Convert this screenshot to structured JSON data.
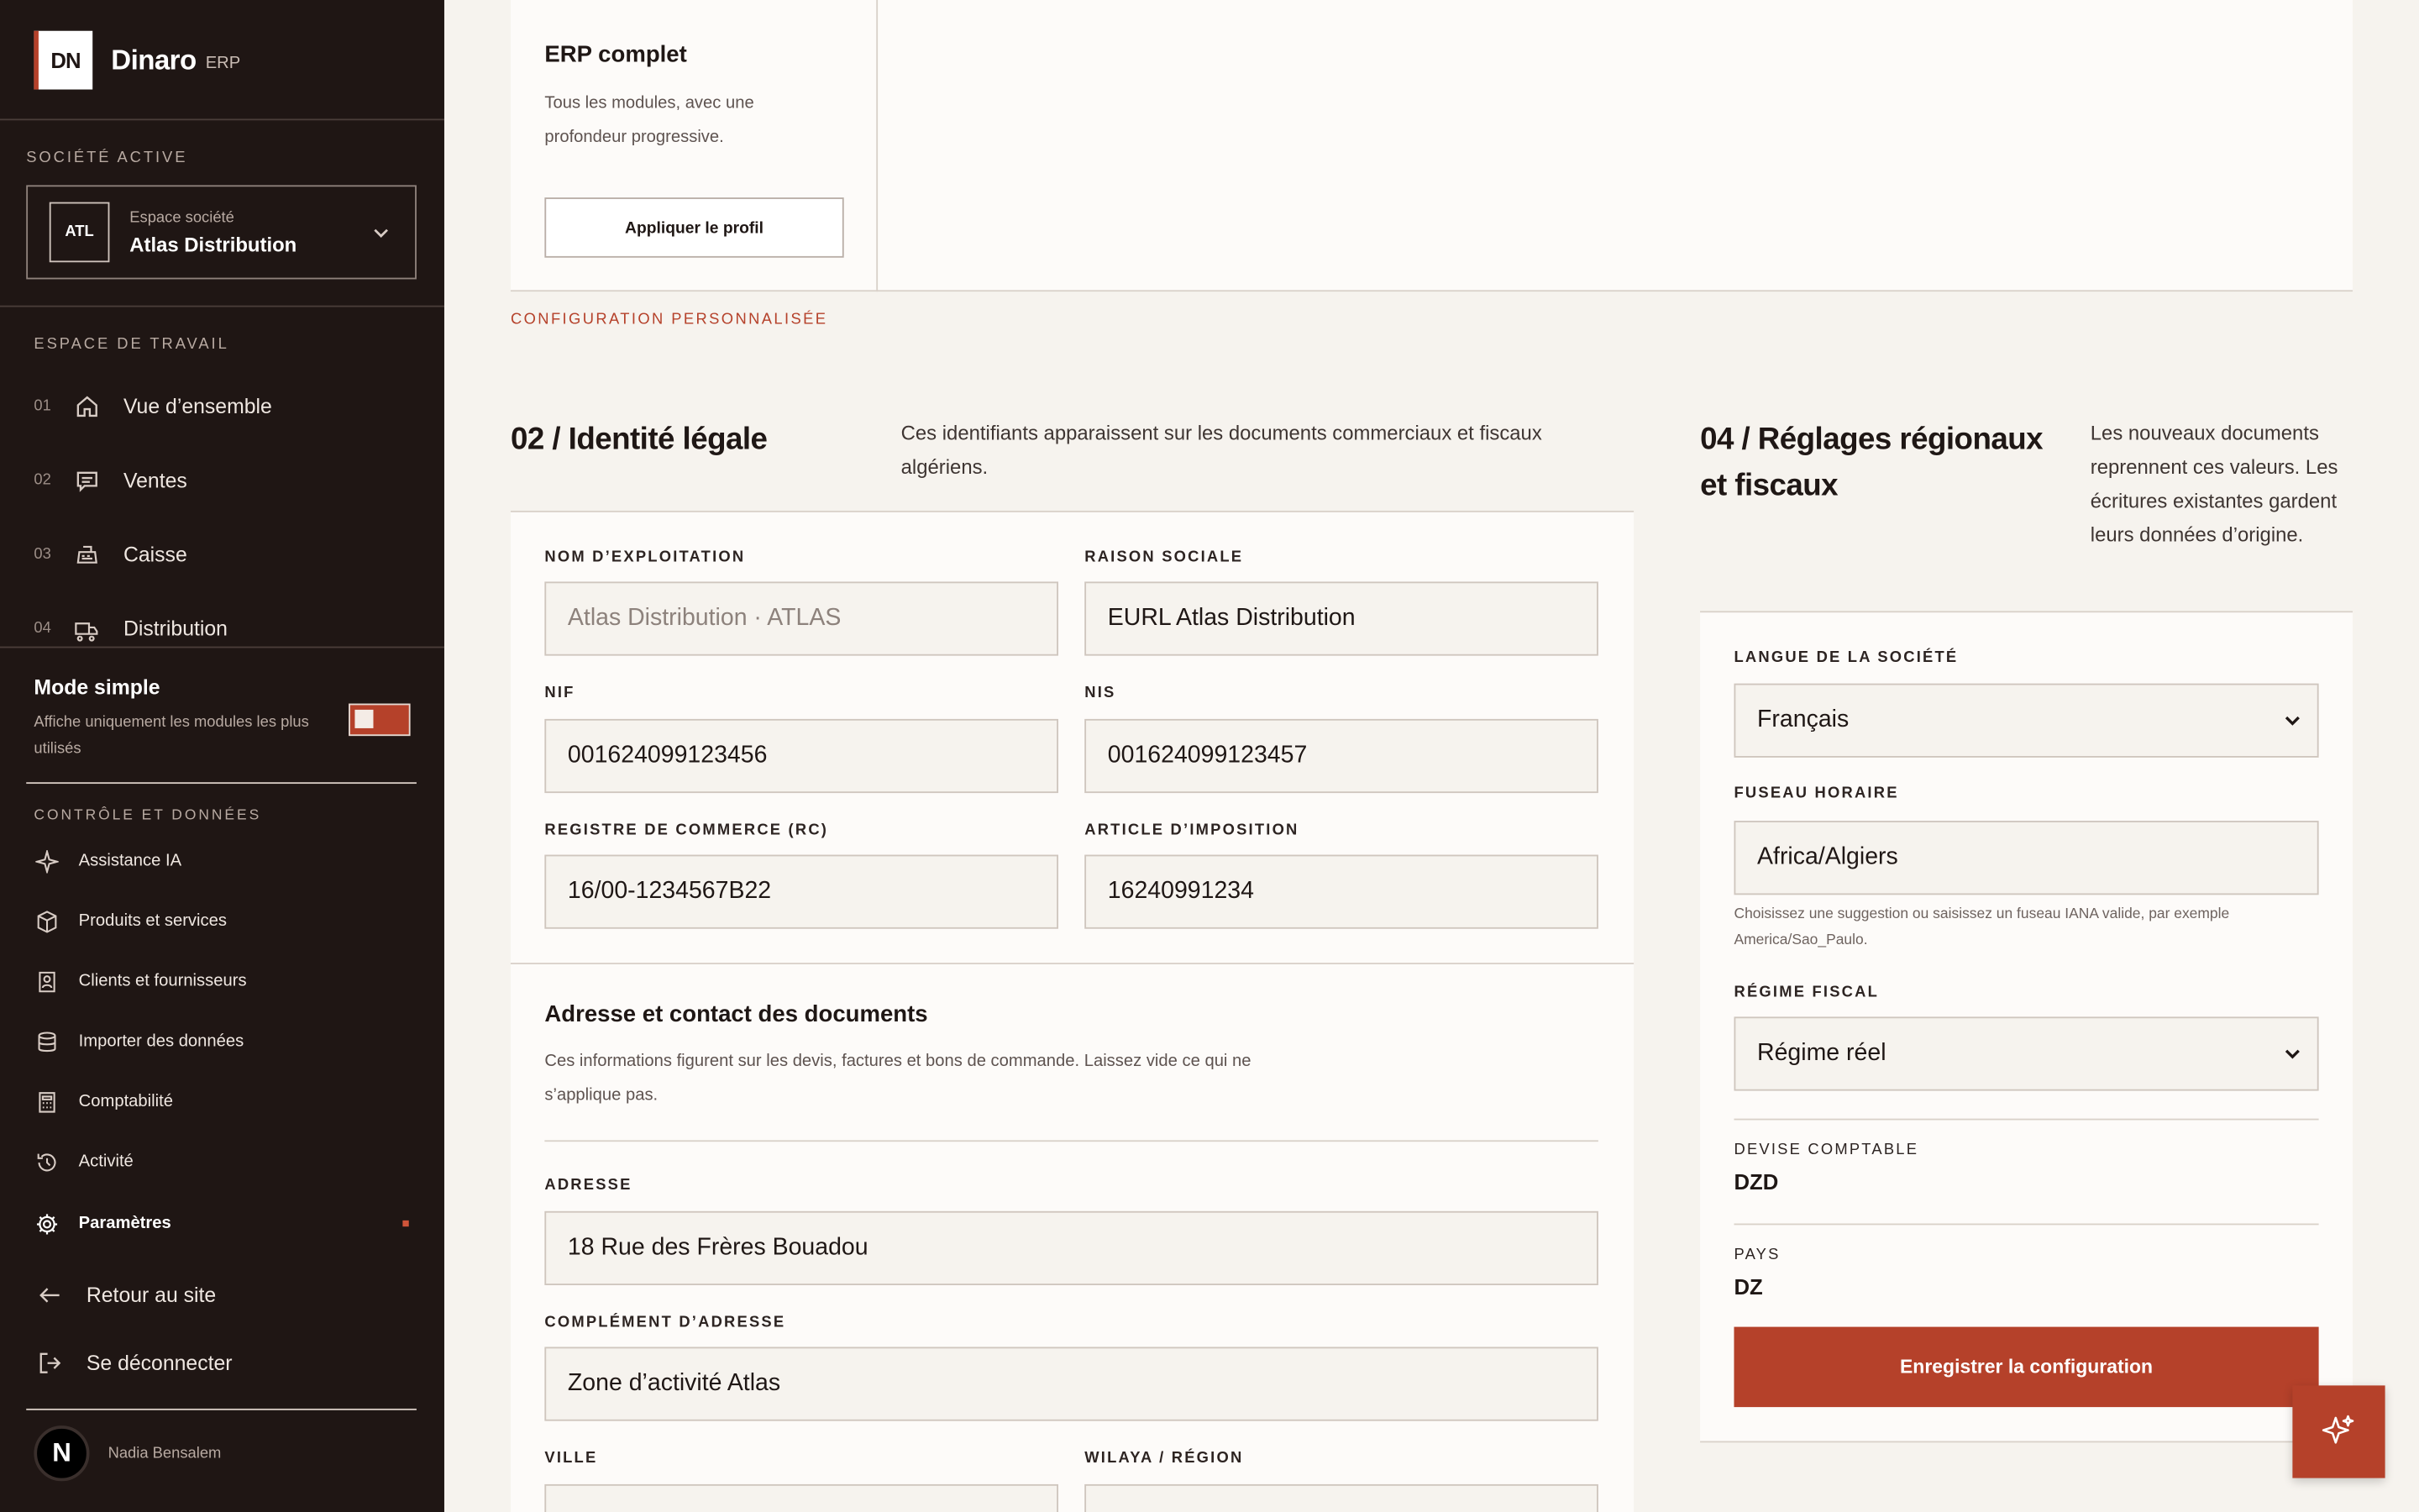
{
  "brand": {
    "logo": "DN",
    "name": "Dinaro",
    "sub": "ERP"
  },
  "company_section": {
    "label": "SOCIÉTÉ ACTIVE",
    "badge": "ATL",
    "caption": "Espace société",
    "name": "Atlas Distribution"
  },
  "workspace": {
    "label": "ESPACE DE TRAVAIL",
    "items": [
      {
        "num": "01",
        "label": "Vue d’ensemble",
        "icon": "home-icon"
      },
      {
        "num": "02",
        "label": "Ventes",
        "icon": "receipt-icon"
      },
      {
        "num": "03",
        "label": "Caisse",
        "icon": "cash-register-icon"
      },
      {
        "num": "04",
        "label": "Distribution",
        "icon": "truck-icon"
      }
    ]
  },
  "simple_mode": {
    "title": "Mode simple",
    "desc": "Affiche uniquement les modules les plus utilisés",
    "enabled": true
  },
  "controls": {
    "label": "CONTRÔLE ET DONNÉES",
    "items": [
      {
        "label": "Assistance IA",
        "icon": "sparkle-icon"
      },
      {
        "label": "Produits et services",
        "icon": "box-icon"
      },
      {
        "label": "Clients et fournisseurs",
        "icon": "contact-card-icon"
      },
      {
        "label": "Importer des données",
        "icon": "database-icon"
      },
      {
        "label": "Comptabilité",
        "icon": "calculator-icon"
      },
      {
        "label": "Activité",
        "icon": "history-icon"
      },
      {
        "label": "Paramètres",
        "icon": "gear-icon"
      }
    ]
  },
  "bottom": {
    "back": "Retour au site",
    "logout": "Se déconnecter"
  },
  "user": {
    "initial": "N",
    "name": "Nadia Bensalem"
  },
  "profile_card": {
    "title": "ERP complet",
    "desc": "Tous les modules, avec une profondeur progressive.",
    "button": "Appliquer le profil"
  },
  "custom_label": "CONFIGURATION PERSONNALISÉE",
  "legal": {
    "title": "02 / Identité légale",
    "desc": "Ces identifiants apparaissent sur les documents commerciaux et fiscaux algériens.",
    "fields": {
      "trade_name": {
        "label": "NOM D’EXPLOITATION",
        "placeholder": "Atlas Distribution · ATLAS"
      },
      "company_name": {
        "label": "RAISON SOCIALE",
        "value": "EURL Atlas Distribution"
      },
      "nif": {
        "label": "NIF",
        "value": "001624099123456"
      },
      "nis": {
        "label": "NIS",
        "value": "001624099123457"
      },
      "rc": {
        "label": "REGISTRE DE COMMERCE (RC)",
        "value": "16/00-1234567B22"
      },
      "tax_article": {
        "label": "ARTICLE D’IMPOSITION",
        "value": "16240991234"
      }
    },
    "address": {
      "title": "Adresse et contact des documents",
      "desc": "Ces informations figurent sur les devis, factures et bons de commande. Laissez vide ce qui ne s’applique pas.",
      "address_label": "ADRESSE",
      "address_value": "18 Rue des Frères Bouadou",
      "complement_label": "COMPLÉMENT D’ADRESSE",
      "complement_value": "Zone d’activité Atlas",
      "city_label": "VILLE",
      "region_label": "WILAYA / RÉGION"
    }
  },
  "regional": {
    "title": "04 / Réglages régionaux et fiscaux",
    "desc": "Les nouveaux documents reprennent ces valeurs. Les écritures existantes gardent leurs données d’origine.",
    "language_label": "LANGUE DE LA SOCIÉTÉ",
    "language_value": "Français",
    "timezone_label": "FUSEAU HORAIRE",
    "timezone_value": "Africa/Algiers",
    "timezone_hint": "Choisissez une suggestion ou saisissez un fuseau IANA valide, par exemple America/Sao_Paulo.",
    "regime_label": "RÉGIME FISCAL",
    "regime_value": "Régime réel",
    "currency_label": "DEVISE COMPTABLE",
    "currency_value": "DZD",
    "country_label": "PAYS",
    "country_value": "DZ",
    "save_button": "Enregistrer la configuration"
  },
  "colors": {
    "accent": "#b5412a",
    "sidebar": "#1f1614",
    "background": "#f6f3ee"
  }
}
